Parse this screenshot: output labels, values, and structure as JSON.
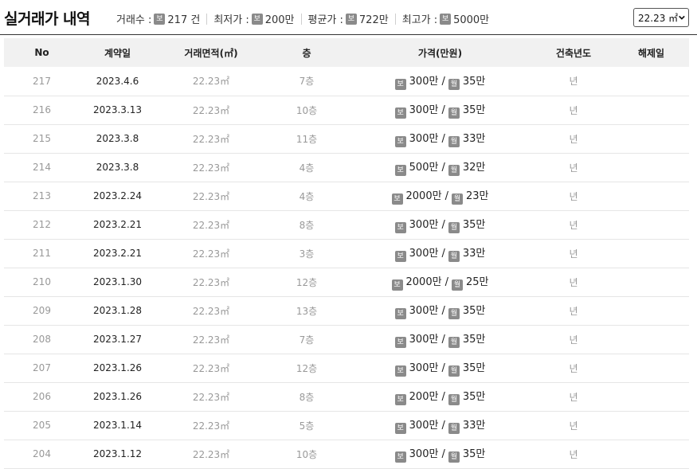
{
  "header": {
    "title": "실거래가 내역",
    "stats": [
      {
        "label": "거래수 :",
        "badge": "보",
        "value": "217 건"
      },
      {
        "label": "최저가 :",
        "badge": "보",
        "value": "200만"
      },
      {
        "label": "평균가 :",
        "badge": "보",
        "value": "722만"
      },
      {
        "label": "최고가 :",
        "badge": "보",
        "value": "5000만"
      }
    ],
    "area_select": {
      "selected": "22.23 ㎡"
    }
  },
  "table": {
    "columns": [
      "No",
      "계약일",
      "거래면적(㎡)",
      "층",
      "가격(만원)",
      "건축년도",
      "해제일"
    ],
    "deposit_badge": "보",
    "monthly_badge": "월",
    "rows": [
      {
        "no": "217",
        "date": "2023.4.6",
        "area": "22.23㎡",
        "floor": "7층",
        "deposit": "300만",
        "monthly": "35만",
        "built": "년",
        "cancel": ""
      },
      {
        "no": "216",
        "date": "2023.3.13",
        "area": "22.23㎡",
        "floor": "10층",
        "deposit": "300만",
        "monthly": "35만",
        "built": "년",
        "cancel": ""
      },
      {
        "no": "215",
        "date": "2023.3.8",
        "area": "22.23㎡",
        "floor": "11층",
        "deposit": "300만",
        "monthly": "33만",
        "built": "년",
        "cancel": ""
      },
      {
        "no": "214",
        "date": "2023.3.8",
        "area": "22.23㎡",
        "floor": "4층",
        "deposit": "500만",
        "monthly": "32만",
        "built": "년",
        "cancel": ""
      },
      {
        "no": "213",
        "date": "2023.2.24",
        "area": "22.23㎡",
        "floor": "4층",
        "deposit": "2000만",
        "monthly": "23만",
        "built": "년",
        "cancel": ""
      },
      {
        "no": "212",
        "date": "2023.2.21",
        "area": "22.23㎡",
        "floor": "8층",
        "deposit": "300만",
        "monthly": "35만",
        "built": "년",
        "cancel": ""
      },
      {
        "no": "211",
        "date": "2023.2.21",
        "area": "22.23㎡",
        "floor": "3층",
        "deposit": "300만",
        "monthly": "33만",
        "built": "년",
        "cancel": ""
      },
      {
        "no": "210",
        "date": "2023.1.30",
        "area": "22.23㎡",
        "floor": "12층",
        "deposit": "2000만",
        "monthly": "25만",
        "built": "년",
        "cancel": ""
      },
      {
        "no": "209",
        "date": "2023.1.28",
        "area": "22.23㎡",
        "floor": "13층",
        "deposit": "300만",
        "monthly": "35만",
        "built": "년",
        "cancel": ""
      },
      {
        "no": "208",
        "date": "2023.1.27",
        "area": "22.23㎡",
        "floor": "7층",
        "deposit": "300만",
        "monthly": "35만",
        "built": "년",
        "cancel": ""
      },
      {
        "no": "207",
        "date": "2023.1.26",
        "area": "22.23㎡",
        "floor": "12층",
        "deposit": "300만",
        "monthly": "35만",
        "built": "년",
        "cancel": ""
      },
      {
        "no": "206",
        "date": "2023.1.26",
        "area": "22.23㎡",
        "floor": "8층",
        "deposit": "200만",
        "monthly": "35만",
        "built": "년",
        "cancel": ""
      },
      {
        "no": "205",
        "date": "2023.1.14",
        "area": "22.23㎡",
        "floor": "5층",
        "deposit": "300만",
        "monthly": "33만",
        "built": "년",
        "cancel": ""
      },
      {
        "no": "204",
        "date": "2023.1.12",
        "area": "22.23㎡",
        "floor": "10층",
        "deposit": "300만",
        "monthly": "35만",
        "built": "년",
        "cancel": ""
      }
    ]
  },
  "colors": {
    "badge": "#8a8a8a",
    "header_bg": "#f1f1f1",
    "muted_text": "#999999",
    "row_border": "#e6e6e6"
  },
  "icons": {
    "select_arrow": "chevron-down-icon"
  }
}
